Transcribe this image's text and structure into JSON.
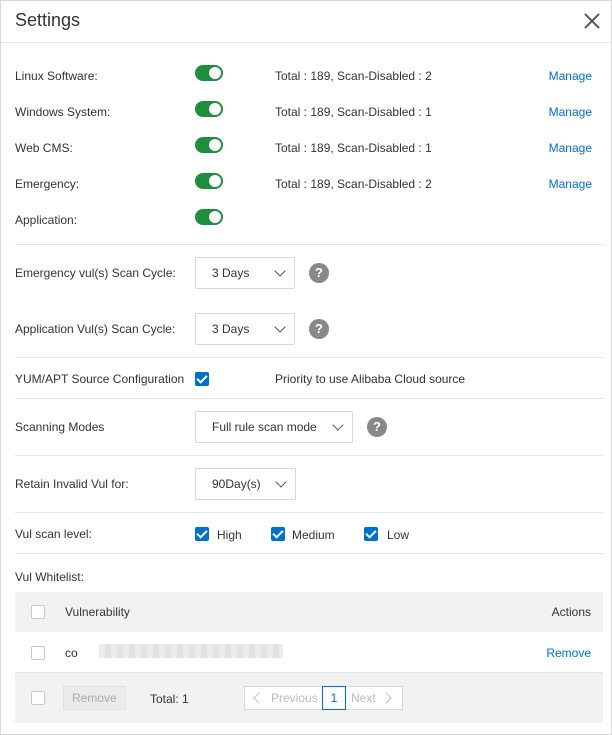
{
  "dialog": {
    "title": "Settings"
  },
  "toggles": [
    {
      "label": "Linux Software:",
      "info": "Total : 189, Scan-Disabled : 2",
      "link": "Manage"
    },
    {
      "label": "Windows System:",
      "info": "Total : 189, Scan-Disabled : 1",
      "link": "Manage"
    },
    {
      "label": "Web CMS:",
      "info": "Total : 189, Scan-Disabled : 1",
      "link": "Manage"
    },
    {
      "label": "Emergency:",
      "info": "Total : 189, Scan-Disabled : 2",
      "link": "Manage"
    },
    {
      "label": "Application:"
    }
  ],
  "emergency_scan": {
    "label": "Emergency vul(s) Scan Cycle:",
    "value": "3 Days"
  },
  "application_scan": {
    "label": "Application Vul(s) Scan Cycle:",
    "value": "3 Days"
  },
  "source_config": {
    "label": "YUM/APT Source Configuration",
    "option": "Priority to use Alibaba Cloud source"
  },
  "scanning_modes": {
    "label": "Scanning Modes",
    "value": "Full rule scan mode"
  },
  "retain": {
    "label": "Retain Invalid Vul for:",
    "value": "90Day(s)"
  },
  "scan_level": {
    "label": "Vul scan level:",
    "options": [
      "High",
      "Medium",
      "Low"
    ]
  },
  "whitelist": {
    "label": "Vul Whitelist:",
    "columns": {
      "vulnerability": "Vulnerability",
      "actions": "Actions"
    },
    "rows": [
      {
        "name": "co",
        "action": "Remove"
      }
    ],
    "footer": {
      "remove": "Remove",
      "total": "Total: 1",
      "previous": "Previous",
      "page": "1",
      "next": "Next"
    }
  },
  "colors": {
    "accent": "#0070cc",
    "toggle": "#1e8e3e"
  }
}
